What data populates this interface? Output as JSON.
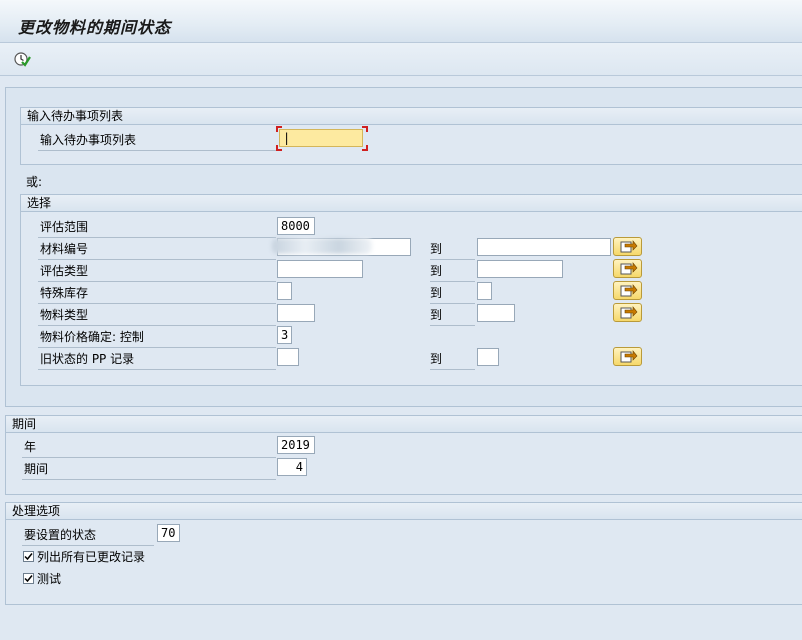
{
  "window": {
    "title": "更改物料的期间状态"
  },
  "toolbar": {
    "execute_icon": "execute-check-clock-icon"
  },
  "worklist": {
    "group_title": "输入待办事项列表",
    "field_label": "输入待办事项列表",
    "field_value": "|"
  },
  "or_label": "或:",
  "selection": {
    "group_title": "选择",
    "to_label": "到",
    "rows": [
      {
        "label": "评估范围",
        "from": "8000"
      },
      {
        "label": "材料编号",
        "from": "",
        "to": ""
      },
      {
        "label": "评估类型",
        "from": "",
        "to": ""
      },
      {
        "label": "特殊库存",
        "from": "",
        "to": ""
      },
      {
        "label": "物料类型",
        "from": "",
        "to": ""
      },
      {
        "label": "物料价格确定: 控制",
        "from": "3"
      },
      {
        "label": "旧状态的 PP 记录",
        "from": "",
        "to": ""
      }
    ]
  },
  "period": {
    "group_title": "期间",
    "year_label": "年",
    "year_value": "2019",
    "period_label": "期间",
    "period_value": "4"
  },
  "processing": {
    "group_title": "处理选项",
    "status_label": "要设置的状态",
    "status_value": "70",
    "list_all_label": "列出所有已更改记录",
    "list_all_checked": true,
    "test_label": "测试",
    "test_checked": true
  },
  "colors": {
    "background": "#dfe8f2",
    "active_field": "#fdeaa0",
    "multi_select": "#f6d86a"
  }
}
